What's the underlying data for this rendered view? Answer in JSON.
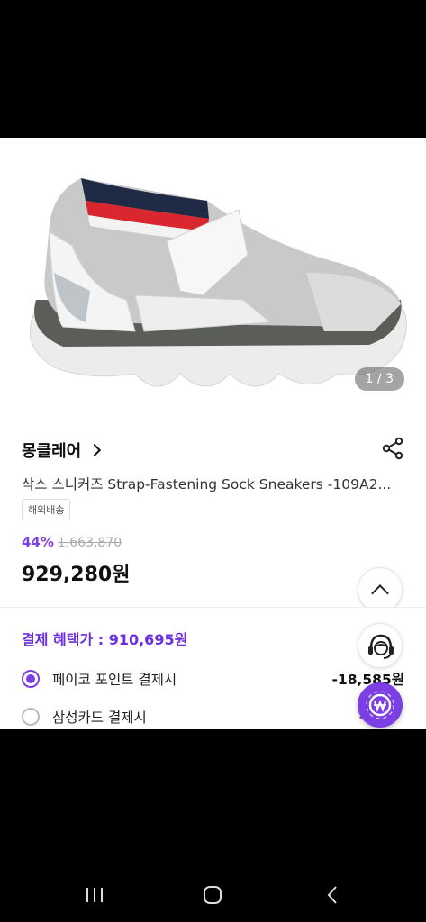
{
  "gallery": {
    "counter": "1 / 3"
  },
  "product": {
    "brand": "몽클레어",
    "title": "삭스 스니커즈 Strap-Fastening Sock Sneakers -109A2...",
    "shipping_badge": "해외배송",
    "discount_rate": "44%",
    "original_price": "1,663,870",
    "sale_price": "929,280원"
  },
  "benefit": {
    "title": "결제 혜택가 : 910,695원",
    "options": [
      {
        "label": "페이코 포인트 결제시",
        "amount": "-18,585원",
        "selected": true
      },
      {
        "label": "삼성카드 결제시",
        "amount": "-10,",
        "selected": false
      }
    ]
  },
  "colors": {
    "accent": "#7b3fe4"
  }
}
